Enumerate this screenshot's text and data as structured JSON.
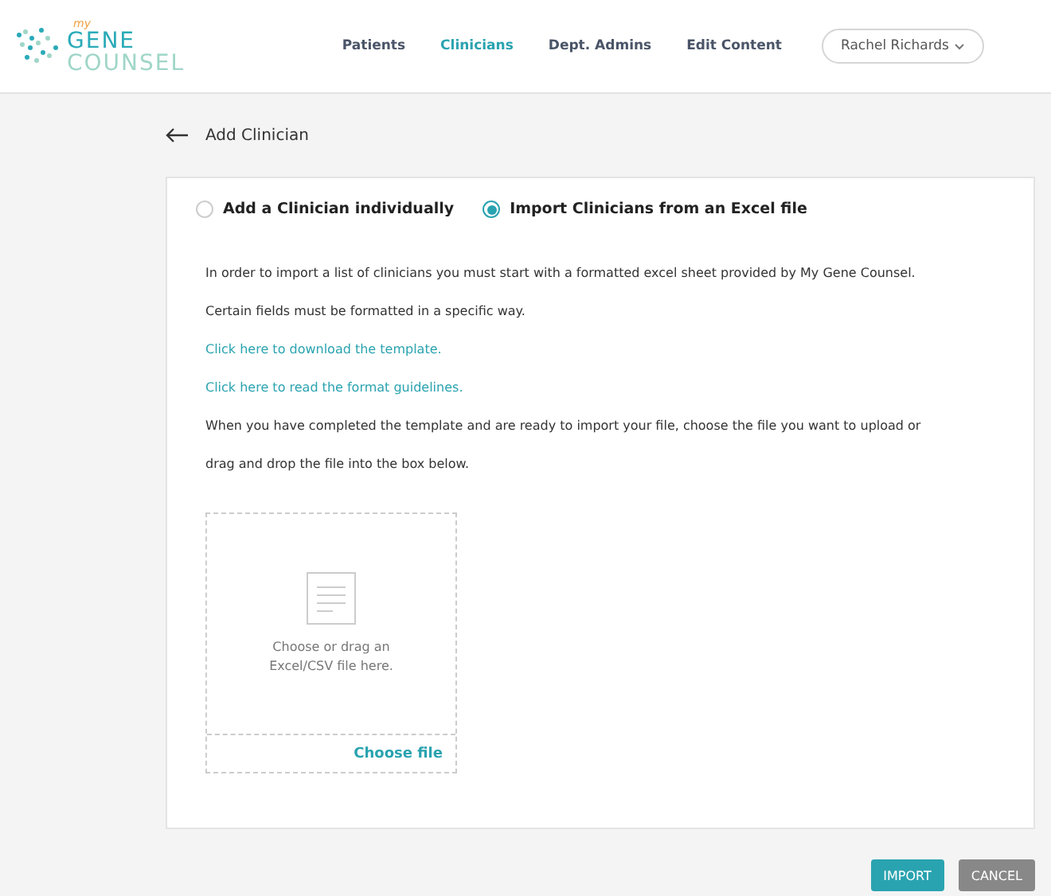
{
  "logo": {
    "small": "my",
    "top": "GENE",
    "bottom": "COUNSEL"
  },
  "nav": [
    {
      "label": "Patients",
      "selected": false
    },
    {
      "label": "Clinicians",
      "selected": true
    },
    {
      "label": "Dept. Admins",
      "selected": false
    },
    {
      "label": "Edit Content",
      "selected": false
    }
  ],
  "user_menu": {
    "label": "Rachel Richards"
  },
  "page_title": "Add Clinician",
  "options": [
    {
      "label": "Add a Clinician individually",
      "selected": false
    },
    {
      "label": "Import Clinicians from an Excel file",
      "selected": true
    }
  ],
  "paragraphs": [
    {
      "kind": "text",
      "text": "In order to import a list of clinicians you must start with a formatted excel sheet provided by My Gene Counsel."
    },
    {
      "kind": "text",
      "text": "Certain fields  must be formatted in a specific way."
    },
    {
      "kind": "link",
      "text": "Click here to download the template."
    },
    {
      "kind": "link",
      "text": "Click here to read the format guidelines."
    },
    {
      "kind": "text",
      "text": "When you have completed the template and are ready to import your file, choose the file you want to upload or"
    },
    {
      "kind": "text",
      "text": "drag and drop the file into the box below."
    }
  ],
  "dropzone": {
    "hint": "Choose or drag an Excel/CSV file here.",
    "action": "Choose file"
  },
  "buttons": [
    {
      "label": "IMPORT",
      "kind": "primary"
    },
    {
      "label": "CANCEL",
      "kind": "secondary"
    }
  ]
}
